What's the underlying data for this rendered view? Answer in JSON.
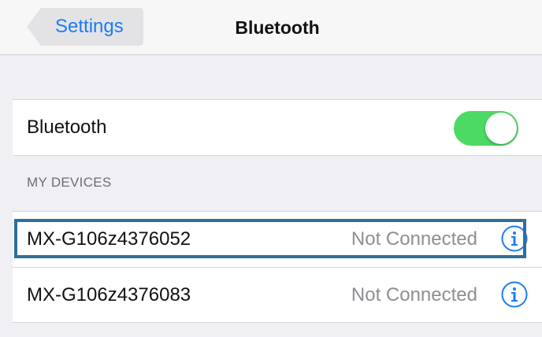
{
  "navbar": {
    "back_label": "Settings",
    "title": "Bluetooth"
  },
  "bluetooth_row": {
    "label": "Bluetooth",
    "toggle_on": true,
    "toggle_color": "#4cd964"
  },
  "devices_section": {
    "header": "MY DEVICES",
    "devices": [
      {
        "name": "MX-G106z4376052",
        "status": "Not Connected",
        "icon": "info-icon",
        "highlighted": true
      },
      {
        "name": "MX-G106z4376083",
        "status": "Not Connected",
        "icon": "info-icon",
        "highlighted": false
      }
    ]
  },
  "colors": {
    "accent": "#1a7cf5",
    "highlight_border": "#2f6e9a",
    "background": "#efeff4"
  }
}
